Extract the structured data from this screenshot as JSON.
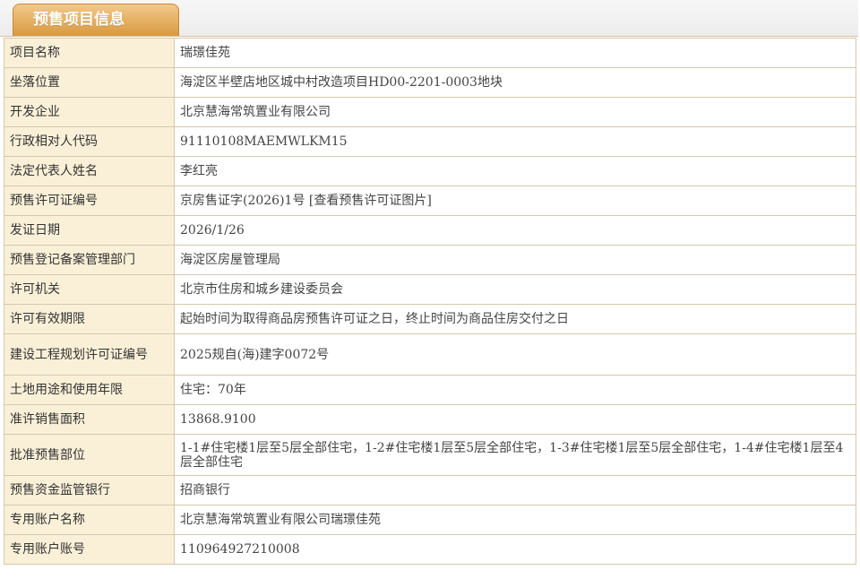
{
  "tab": {
    "title": "预售项目信息"
  },
  "rows": [
    {
      "label": "项目名称",
      "value": "瑞璟佳苑"
    },
    {
      "label": "坐落位置",
      "value": "海淀区半壁店地区城中村改造项目HD00-2201-0003地块"
    },
    {
      "label": "开发企业",
      "value": "北京慧海常筑置业有限公司"
    },
    {
      "label": "行政相对人代码",
      "value": "91110108MAEMWLKM15"
    },
    {
      "label": "法定代表人姓名",
      "value": "李红亮"
    },
    {
      "label": "预售许可证编号",
      "value": "京房售证字(2026)1号",
      "link": "[查看预售许可证图片]"
    },
    {
      "label": "发证日期",
      "value": "2026/1/26"
    },
    {
      "label": "预售登记备案管理部门",
      "value": "海淀区房屋管理局"
    },
    {
      "label": "许可机关",
      "value": "北京市住房和城乡建设委员会"
    },
    {
      "label": "许可有效期限",
      "value": "起始时间为取得商品房预售许可证之日，终止时间为商品住房交付之日"
    },
    {
      "label": "建设工程规划许可证编号",
      "value": "2025规自(海)建字0072号"
    },
    {
      "label": "土地用途和使用年限",
      "value": "住宅：70年"
    },
    {
      "label": "准许销售面积",
      "value": "13868.9100"
    },
    {
      "label": "批准预售部位",
      "value": "1-1#住宅楼1层至5层全部住宅，1-2#住宅楼1层至5层全部住宅，1-3#住宅楼1层至5层全部住宅，1-4#住宅楼1层至4层全部住宅"
    },
    {
      "label": "预售资金监管银行",
      "value": "招商银行"
    },
    {
      "label": "专用账户名称",
      "value": "北京慧海常筑置业有限公司瑞璟佳苑"
    },
    {
      "label": "专用账户账号",
      "value": "110964927210008"
    }
  ],
  "colors": {
    "label_bg": "#faf0d8",
    "border": "#d6c7ac",
    "tab_top": "#f2c98b",
    "tab_bottom": "#d8993e"
  }
}
